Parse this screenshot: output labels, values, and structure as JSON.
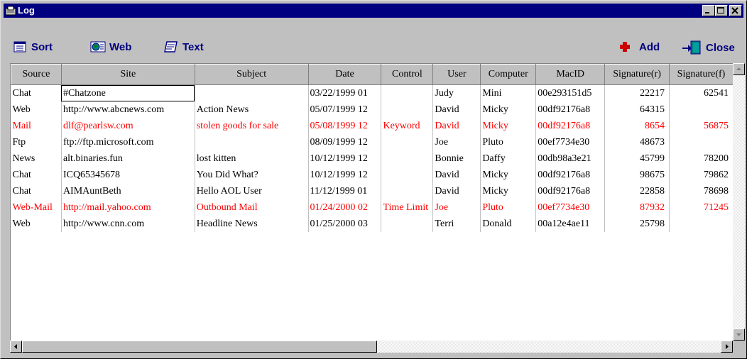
{
  "window": {
    "title": "Log"
  },
  "toolbar": {
    "sort_label": "Sort",
    "web_label": "Web",
    "text_label": "Text",
    "add_label": "Add",
    "close_label": "Close"
  },
  "colors": {
    "titlebar": "#000080",
    "flagged_row": "#ff0000",
    "tool_text": "#000080",
    "add_icon": "#cc0000"
  },
  "table": {
    "columns": [
      "Source",
      "Site",
      "Subject",
      "Date",
      "Control",
      "User",
      "Computer",
      "MacID",
      "Signature(r)",
      "Signature(f)"
    ],
    "rows": [
      {
        "flagged": false,
        "cells": [
          "Chat",
          "#Chatzone",
          "",
          "03/22/1999 01",
          "",
          "Judy",
          "Mini",
          "00e293151d5",
          "22217",
          "62541"
        ]
      },
      {
        "flagged": false,
        "cells": [
          "Web",
          "http://www.abcnews.com",
          "Action News",
          "05/07/1999 12",
          "",
          "David",
          "Micky",
          "00df92176a8",
          "64315",
          ""
        ]
      },
      {
        "flagged": true,
        "cells": [
          "Mail",
          "dlf@pearlsw.com",
          "stolen goods for sale",
          "05/08/1999 12",
          "Keyword",
          "David",
          "Micky",
          "00df92176a8",
          "8654",
          "56875"
        ]
      },
      {
        "flagged": false,
        "cells": [
          "Ftp",
          "ftp://ftp.microsoft.com",
          "",
          "08/09/1999 12",
          "",
          "Joe",
          "Pluto",
          "00ef7734e30",
          "48673",
          ""
        ]
      },
      {
        "flagged": false,
        "cells": [
          "News",
          "alt.binaries.fun",
          "lost kitten",
          "10/12/1999 12",
          "",
          "Bonnie",
          "Daffy",
          "00db98a3e21",
          "45799",
          "78200"
        ]
      },
      {
        "flagged": false,
        "cells": [
          "Chat",
          "ICQ65345678",
          "You Did What?",
          "10/12/1999 12",
          "",
          "David",
          "Micky",
          "00df92176a8",
          "98675",
          "79862"
        ]
      },
      {
        "flagged": false,
        "cells": [
          "Chat",
          "AIMAuntBeth",
          "Hello AOL User",
          "11/12/1999 01",
          "",
          "David",
          "Micky",
          "00df92176a8",
          "22858",
          "78698"
        ]
      },
      {
        "flagged": true,
        "cells": [
          "Web-Mail",
          "http://mail.yahoo.com",
          "Outbound Mail",
          "01/24/2000 02",
          "Time Limit",
          "Joe",
          "Pluto",
          "00ef7734e30",
          "87932",
          "71245"
        ]
      },
      {
        "flagged": false,
        "cells": [
          "Web",
          "http://www.cnn.com",
          "Headline News",
          "01/25/2000 03",
          "",
          "Terri",
          "Donald",
          "00a12e4ae11",
          "25798",
          ""
        ]
      }
    ]
  }
}
